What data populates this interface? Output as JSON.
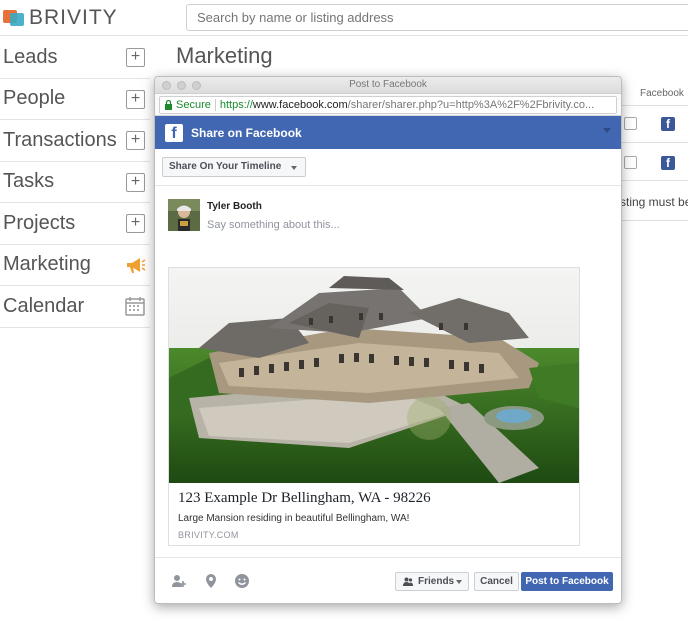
{
  "brand": {
    "name": "BRIVITY"
  },
  "search": {
    "placeholder": "Search by name or listing address"
  },
  "sidebar": {
    "items": [
      {
        "label": "Leads",
        "icon": "plus-icon"
      },
      {
        "label": "People",
        "icon": "plus-icon"
      },
      {
        "label": "Transactions",
        "icon": "plus-icon"
      },
      {
        "label": "Tasks",
        "icon": "plus-icon"
      },
      {
        "label": "Projects",
        "icon": "plus-icon"
      },
      {
        "label": "Marketing",
        "icon": "megaphone-icon"
      },
      {
        "label": "Calendar",
        "icon": "calendar-icon"
      }
    ]
  },
  "main": {
    "title": "Marketing",
    "table_header": "Facebook",
    "note_fragment": "sting must be"
  },
  "popup": {
    "window_title": "Post to Facebook",
    "url": {
      "secure_label": "Secure",
      "scheme": "https://",
      "host": "www.facebook.com",
      "path": "/sharer/sharer.php?u=http%3A%2F%2Fbrivity.co..."
    },
    "header_title": "Share on Facebook",
    "share_target": "Share On Your Timeline",
    "user_name": "Tyler Booth",
    "composer_placeholder": "Say something about this...",
    "card": {
      "title": "123 Example Dr Bellingham, WA - 98226",
      "description": "Large Mansion residing in beautiful Bellingham, WA!",
      "domain": "BRIVITY.COM"
    },
    "footer": {
      "audience_label": "Friends",
      "cancel_label": "Cancel",
      "post_label": "Post to Facebook"
    }
  },
  "colors": {
    "facebook_blue": "#4267b2",
    "marketing_icon": "#f0a030",
    "secure_green": "#1a8a2e"
  }
}
